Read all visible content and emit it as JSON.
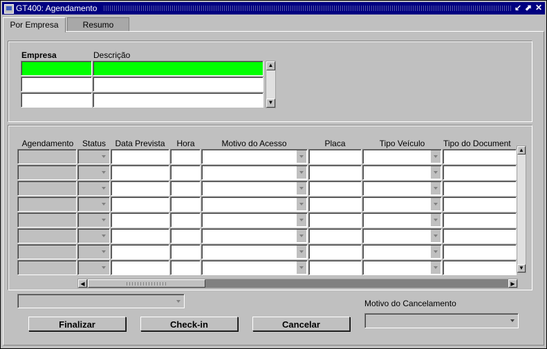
{
  "window": {
    "title": "GT400: Agendamento",
    "buttons": [
      "↙",
      "⬈",
      "✕"
    ]
  },
  "tabs": [
    {
      "label": "Por Empresa",
      "active": true
    },
    {
      "label": "Resumo",
      "active": false
    }
  ],
  "empresa": {
    "headers": {
      "empresa": "Empresa",
      "descricao": "Descrição"
    },
    "rows": [
      {
        "empresa": "",
        "descricao": ""
      },
      {
        "empresa": "",
        "descricao": ""
      },
      {
        "empresa": "",
        "descricao": ""
      }
    ]
  },
  "agendamento": {
    "columns": [
      "Agendamento",
      "Status",
      "Data Prevista",
      "Hora",
      "Motivo do Acesso",
      "Placa",
      "Tipo Veículo",
      "Tipo do Document"
    ],
    "row_count": 8
  },
  "footer": {
    "motivo_label": "Motivo do Cancelamento",
    "finalizar": "Finalizar",
    "checkin": "Check-in",
    "cancelar": "Cancelar"
  },
  "colors": {
    "title_bar": "#000080",
    "selected_row": "#00ff00",
    "face": "#c0c0c0"
  }
}
